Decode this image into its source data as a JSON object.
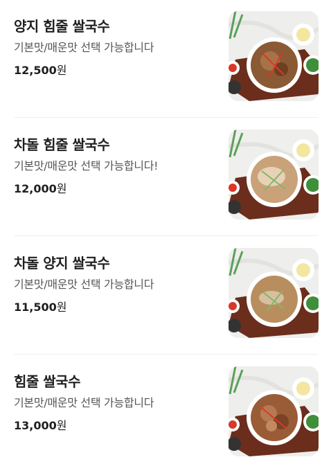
{
  "menu": {
    "items": [
      {
        "name": "양지 힘줄 쌀국수",
        "description": "기본맛/매운맛 선택 가능합니다",
        "price": "12,500",
        "currency": "원",
        "image": "beef-brisket-tendon-pho-photo",
        "broth_color": "#8a5a34"
      },
      {
        "name": "차돌 힘줄 쌀국수",
        "description": "기본맛/매운맛 선택 가능합니다!",
        "price": "12,000",
        "currency": "원",
        "image": "beef-plate-tendon-pho-photo",
        "broth_color": "#c9a27a"
      },
      {
        "name": "차돌 양지 쌀국수",
        "description": "기본맛/매운맛 선택 가능합니다",
        "price": "11,500",
        "currency": "원",
        "image": "beef-plate-brisket-pho-photo",
        "broth_color": "#b98e5f"
      },
      {
        "name": "힘줄 쌀국수",
        "description": "기본맛/매운맛 선택 가능합니다",
        "price": "13,000",
        "currency": "원",
        "image": "tendon-pho-photo",
        "broth_color": "#9a5c36"
      }
    ]
  },
  "colors": {
    "title_text": "#1e1e1e",
    "desc_text": "#555555",
    "divider": "#eeeeee",
    "tray": "#6b2e1c",
    "bowl": "#ffffff",
    "herbs": "#3f8f3a",
    "sauce_red": "#d9382a",
    "pickled_onion": "#f3e6a0"
  }
}
